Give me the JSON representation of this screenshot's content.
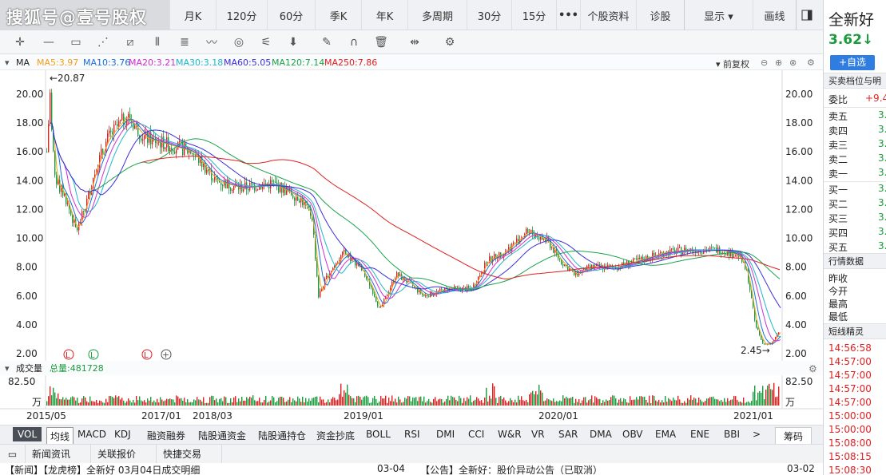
{
  "watermark": "搜狐号@壹号股权",
  "period_tabs": [
    "月K",
    "120分",
    "60分",
    "季K",
    "年K",
    "多周期",
    "30分",
    "15分",
    "•••",
    "个股资料",
    "诊股",
    "显示 ▾",
    "画线"
  ],
  "ma_legend": {
    "label": "MA",
    "items": [
      {
        "text": "MA5:3.97",
        "color": "#f0a020"
      },
      {
        "text": "MA10:3.76",
        "color": "#1e6fd9"
      },
      {
        "text": "MA20:3.21",
        "color": "#d12fd1"
      },
      {
        "text": "MA30:3.18",
        "color": "#1fb7c9"
      },
      {
        "text": "MA60:5.05",
        "color": "#3b2fd9"
      },
      {
        "text": "MA120:7.14",
        "color": "#1aa34a"
      },
      {
        "text": "MA250:7.86",
        "color": "#e02020"
      }
    ],
    "adjust": "前复权"
  },
  "price_axis": [
    "20.00",
    "18.00",
    "16.00",
    "14.00",
    "12.00",
    "10.00",
    "8.00",
    "6.00",
    "4.00",
    "2.00"
  ],
  "annotations": {
    "high": "←20.87",
    "low": "2.45→"
  },
  "markers": [
    "L",
    "L",
    "L",
    "+"
  ],
  "volume": {
    "title": "成交量",
    "total": "总量:481728",
    "axis_top": "82.50",
    "axis_unit": "万"
  },
  "date_axis": [
    "2015/05",
    "2017/01",
    "2018/03",
    "2019/01",
    "2020/01",
    "2021/01"
  ],
  "indicator_tabs": [
    "VOL",
    "均线",
    "MACD",
    "KDJ",
    "融资融券",
    "陆股通资金",
    "陆股通持仓",
    "资金抄底",
    "BOLL",
    "RSI",
    "DMI",
    "CCI",
    "W&R",
    "VR",
    "SAR",
    "DMA",
    "OBV",
    "EMA",
    "ENE",
    "BBI",
    ">",
    "筹码"
  ],
  "news_tabs": [
    "新闻资讯",
    "关联报价",
    "快捷交易"
  ],
  "news": [
    {
      "text": "【新闻】【龙虎榜】全新好 03月04日成交明细",
      "date": "03-04"
    },
    {
      "text": "【公告】全新好：股价异动公告（已取消）",
      "date": "03-02"
    }
  ],
  "stock": {
    "name": "全新好",
    "price": "3.62",
    "arrow": "↓",
    "price_color": "#1a9b3c",
    "add_button": "+自选"
  },
  "orderbook": {
    "title": "买卖档位与明",
    "ratio_label": "委比",
    "ratio_value": "+9.4",
    "sells": [
      {
        "label": "卖五",
        "price": "3."
      },
      {
        "label": "卖四",
        "price": "3."
      },
      {
        "label": "卖三",
        "price": "3."
      },
      {
        "label": "卖二",
        "price": "3."
      },
      {
        "label": "卖一",
        "price": "3."
      }
    ],
    "buys": [
      {
        "label": "买一",
        "price": "3."
      },
      {
        "label": "买二",
        "price": "3."
      },
      {
        "label": "买三",
        "price": "3."
      },
      {
        "label": "买四",
        "price": "3."
      },
      {
        "label": "买五",
        "price": "3."
      }
    ]
  },
  "quote": {
    "title": "行情数据",
    "rows": [
      "昨收",
      "今开",
      "最高",
      "最低"
    ]
  },
  "sprite": {
    "title": "短线精灵",
    "times": [
      "14:56:58",
      "14:57:00",
      "14:57:00",
      "14:57:00",
      "14:57:00",
      "15:00:00",
      "15:00:00",
      "15:08:00",
      "15:08:15",
      "15:08:30"
    ],
    "time_color": "#e02020"
  },
  "colors": {
    "up": "#e02020",
    "down": "#1a9b3c"
  }
}
